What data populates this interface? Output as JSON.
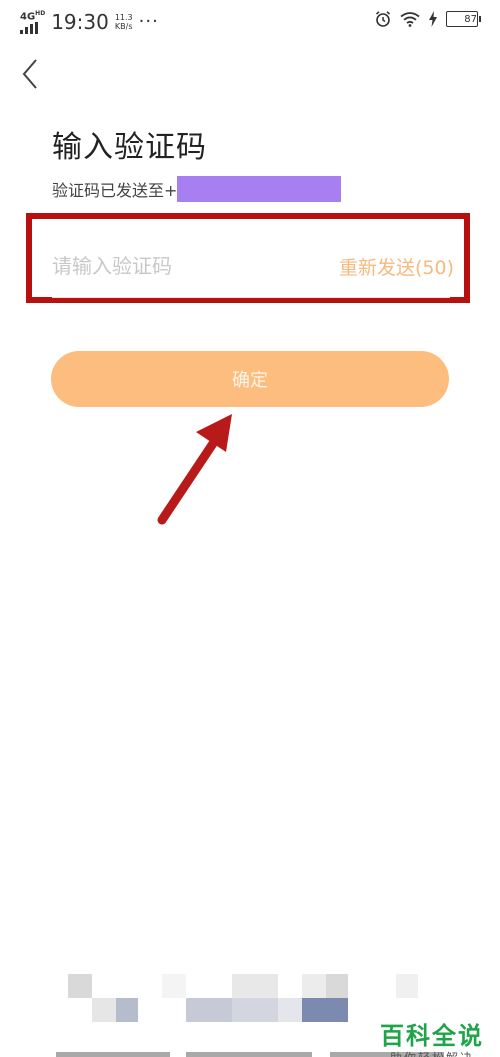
{
  "status_bar": {
    "network": "4G",
    "network_hd": "HD",
    "time": "19:30",
    "speed_value": "11.3",
    "speed_unit": "KB/s",
    "more": "···",
    "battery": "87",
    "battery_level": 0.87,
    "icons": [
      "signal-icon",
      "alarm-icon",
      "wifi-icon",
      "charging-icon",
      "battery-icon"
    ]
  },
  "nav": {
    "back_icon": "chevron-left-icon"
  },
  "title": "输入验证码",
  "subtitle": "验证码已发送至+",
  "code_input": {
    "placeholder": "请输入验证码",
    "value": ""
  },
  "resend_label": "重新发送(50)",
  "confirm_label": "确定",
  "watermark": {
    "main": "百科全说",
    "sub": "助你轻松解决"
  },
  "colors": {
    "accent": "#fdbd7f",
    "resend": "#f6b97e",
    "highlight": "#b80f0f",
    "mask": "#a87ff0",
    "watermark": "#1fa44a"
  }
}
